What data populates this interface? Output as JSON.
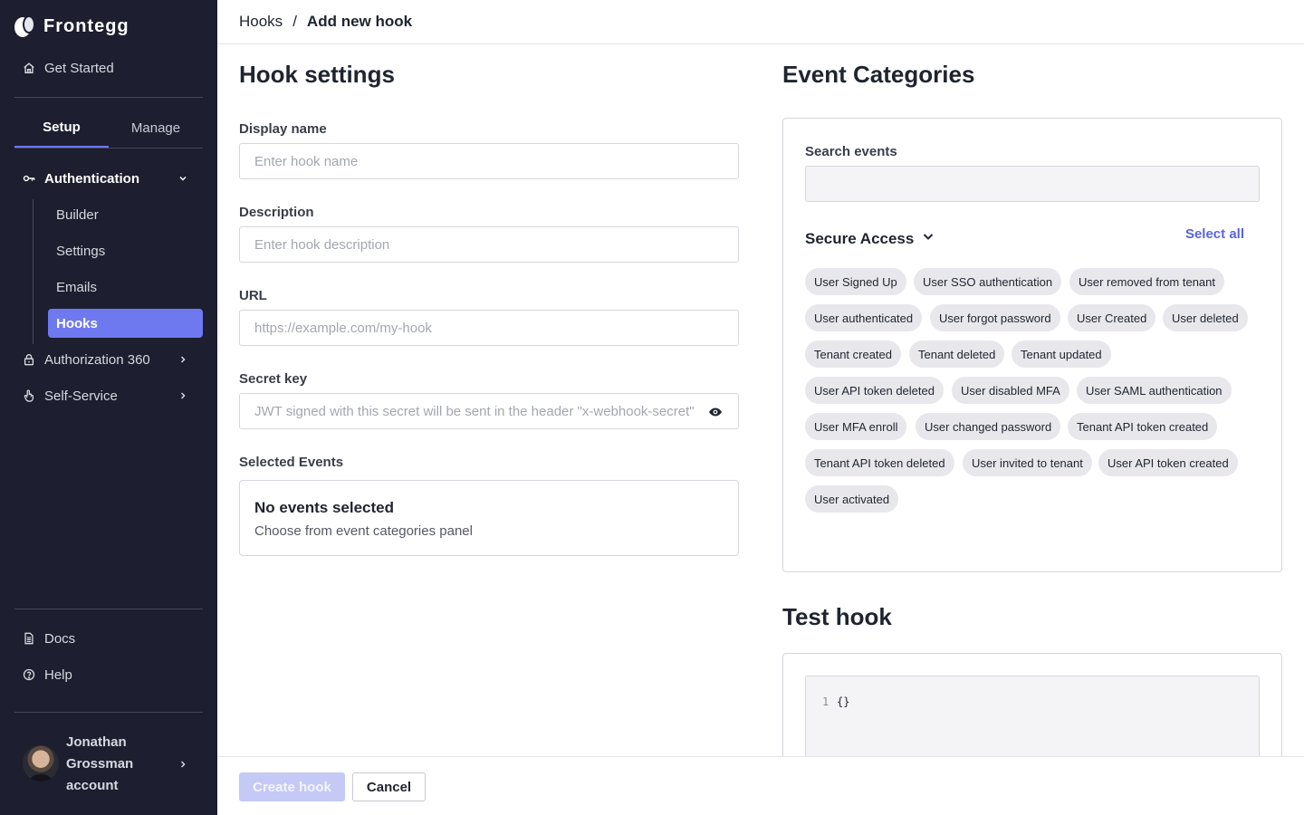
{
  "sidebar": {
    "logo_text": "Frontegg",
    "get_started": "Get Started",
    "tabs": [
      {
        "label": "Setup"
      },
      {
        "label": "Manage"
      }
    ],
    "authentication": "Authentication",
    "auth_items": [
      {
        "label": "Builder"
      },
      {
        "label": "Settings"
      },
      {
        "label": "Emails"
      },
      {
        "label": "Hooks"
      }
    ],
    "authorization": "Authorization 360",
    "self_service": "Self-Service",
    "docs": "Docs",
    "help": "Help",
    "user_name": "Jonathan Grossman account"
  },
  "breadcrumb": {
    "root": "Hooks",
    "separator": "/",
    "current": "Add new hook"
  },
  "hook_settings": {
    "title": "Hook settings",
    "display_name_label": "Display name",
    "display_name_placeholder": "Enter hook name",
    "description_label": "Description",
    "description_placeholder": "Enter hook description",
    "url_label": "URL",
    "url_placeholder": "https://example.com/my-hook",
    "secret_label": "Secret key",
    "secret_placeholder": "JWT signed with this secret will be sent in the header \"x-webhook-secret\" of",
    "selected_events_label": "Selected Events",
    "no_events_title": "No events selected",
    "no_events_sub": "Choose from event categories panel"
  },
  "event_categories": {
    "title": "Event Categories",
    "search_label": "Search events",
    "category": "Secure Access",
    "select_all": "Select all",
    "chips": [
      "User Signed Up",
      "User SSO authentication",
      "User removed from tenant",
      "User authenticated",
      "User forgot password",
      "User Created",
      "User deleted",
      "Tenant created",
      "Tenant deleted",
      "Tenant updated",
      "User API token deleted",
      "User disabled MFA",
      "User SAML authentication",
      "User MFA enroll",
      "User changed password",
      "Tenant API token created",
      "Tenant API token deleted",
      "User invited to tenant",
      "User API token created",
      "User activated"
    ]
  },
  "test_hook": {
    "title": "Test hook",
    "line_number": "1",
    "code": "{}"
  },
  "footer": {
    "create_label": "Create hook",
    "cancel_label": "Cancel"
  },
  "colors": {
    "sidebar_bg": "#1d1e2f",
    "accent": "#6e79f0",
    "link": "#5a64e0",
    "chip_bg": "#e8e8ec"
  }
}
